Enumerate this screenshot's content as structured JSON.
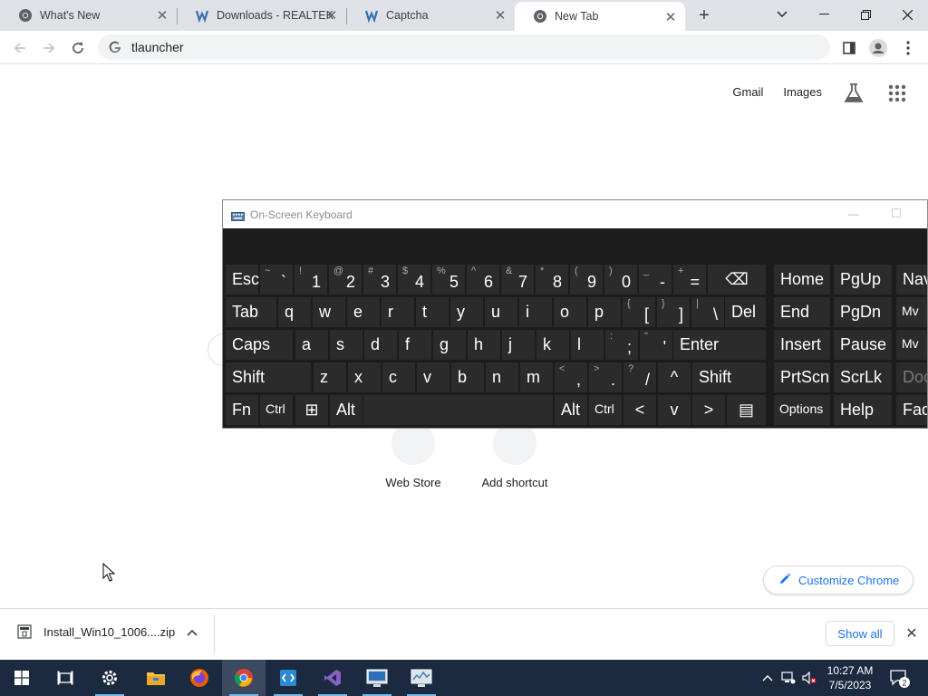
{
  "browser": {
    "tabs": [
      {
        "title": "What's New",
        "icon": "chrome-icon",
        "active": false
      },
      {
        "title": "Downloads - REALTEK",
        "icon": "site-logo-icon",
        "active": false
      },
      {
        "title": "Captcha",
        "icon": "site-logo-icon",
        "active": false
      },
      {
        "title": "New Tab",
        "icon": "chrome-icon",
        "active": true
      }
    ],
    "omnibox": {
      "text": "tlauncher"
    }
  },
  "ntp": {
    "links": {
      "gmail": "Gmail",
      "images": "Images"
    },
    "shortcuts": [
      {
        "label": "Web Store"
      },
      {
        "label": "Add shortcut"
      }
    ],
    "customize_label": "Customize Chrome"
  },
  "osk": {
    "title": "On-Screen Keyboard",
    "rows": [
      [
        {
          "main": "Esc"
        },
        {
          "shift": "~",
          "main": "`"
        },
        {
          "shift": "!",
          "main": "1"
        },
        {
          "shift": "@",
          "main": "2"
        },
        {
          "shift": "#",
          "main": "3"
        },
        {
          "shift": "$",
          "main": "4"
        },
        {
          "shift": "%",
          "main": "5"
        },
        {
          "shift": "^",
          "main": "6"
        },
        {
          "shift": "&",
          "main": "7"
        },
        {
          "shift": "*",
          "main": "8"
        },
        {
          "shift": "(",
          "main": "9"
        },
        {
          "shift": ")",
          "main": "0"
        },
        {
          "shift": "_",
          "main": "-"
        },
        {
          "shift": "+",
          "main": "="
        },
        {
          "main": "⌫"
        },
        {
          "main": "Home"
        },
        {
          "main": "PgUp"
        },
        {
          "main": "Nav"
        }
      ],
      [
        {
          "main": "Tab"
        },
        {
          "main": "q"
        },
        {
          "main": "w"
        },
        {
          "main": "e"
        },
        {
          "main": "r"
        },
        {
          "main": "t"
        },
        {
          "main": "y"
        },
        {
          "main": "u"
        },
        {
          "main": "i"
        },
        {
          "main": "o"
        },
        {
          "main": "p"
        },
        {
          "shift": "{",
          "main": "["
        },
        {
          "shift": "}",
          "main": "]"
        },
        {
          "shift": "|",
          "main": "\\"
        },
        {
          "main": "Del"
        },
        {
          "main": "End"
        },
        {
          "main": "PgDn"
        },
        {
          "main": "Mv"
        }
      ],
      [
        {
          "main": "Caps"
        },
        {
          "main": "a"
        },
        {
          "main": "s"
        },
        {
          "main": "d"
        },
        {
          "main": "f"
        },
        {
          "main": "g"
        },
        {
          "main": "h"
        },
        {
          "main": "j"
        },
        {
          "main": "k"
        },
        {
          "main": "l"
        },
        {
          "shift": ":",
          "main": ";"
        },
        {
          "shift": "\"",
          "main": "'"
        },
        {
          "main": "Enter"
        },
        {
          "main": "Insert"
        },
        {
          "main": "Pause"
        },
        {
          "main": "Mv"
        }
      ],
      [
        {
          "main": "Shift"
        },
        {
          "main": "z"
        },
        {
          "main": "x"
        },
        {
          "main": "c"
        },
        {
          "main": "v"
        },
        {
          "main": "b"
        },
        {
          "main": "n"
        },
        {
          "main": "m"
        },
        {
          "shift": "<",
          "main": ","
        },
        {
          "shift": ">",
          "main": "."
        },
        {
          "shift": "?",
          "main": "/"
        },
        {
          "main": "^"
        },
        {
          "main": "Shift"
        },
        {
          "main": "PrtScn"
        },
        {
          "main": "ScrLk"
        },
        {
          "main": "Doc"
        }
      ],
      [
        {
          "main": "Fn"
        },
        {
          "main": "Ctrl"
        },
        {
          "main": "⊞"
        },
        {
          "main": "Alt"
        },
        {
          "main": ""
        },
        {
          "main": "Alt"
        },
        {
          "main": "Ctrl"
        },
        {
          "main": "<"
        },
        {
          "main": "v"
        },
        {
          "main": ">"
        },
        {
          "main": "▤"
        },
        {
          "main": "Options"
        },
        {
          "main": "Help"
        },
        {
          "main": "Fad"
        }
      ]
    ]
  },
  "downloads": {
    "file_name": "Install_Win10_1006....zip",
    "show_all": "Show all"
  },
  "taskbar": {
    "apps": [
      {
        "name": "task-view-icon"
      },
      {
        "name": "settings-icon"
      },
      {
        "name": "file-explorer-icon"
      },
      {
        "name": "firefox-icon"
      },
      {
        "name": "chrome-icon",
        "active": true
      },
      {
        "name": "vs-code-icon"
      },
      {
        "name": "visual-studio-icon"
      },
      {
        "name": "remote-desktop-icon"
      },
      {
        "name": "monitor-app-icon"
      }
    ],
    "time": "10:27 AM",
    "date": "7/5/2023",
    "notification_count": "2"
  },
  "colors": {
    "accent_blue": "#1a73e8",
    "taskbar": "#1b2a3f",
    "osk_bg": "#1c1c1c",
    "osk_key": "#2b2b2b"
  }
}
